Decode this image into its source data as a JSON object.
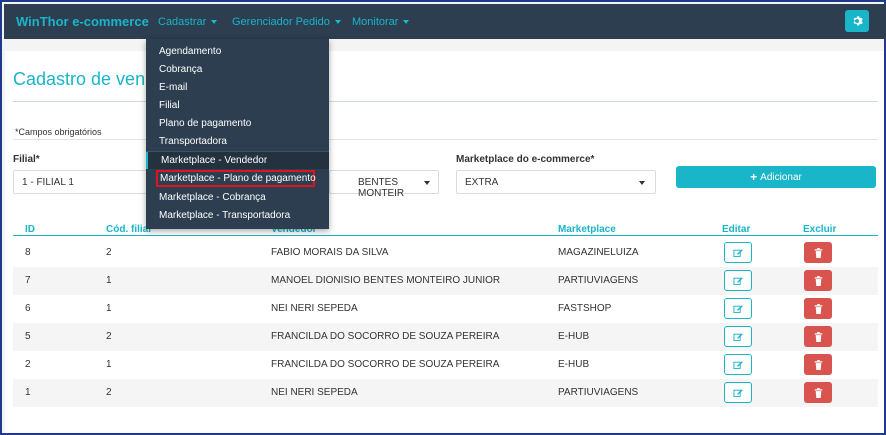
{
  "navbar": {
    "brand": "WinThor e-commerce",
    "menus": [
      {
        "label": "Cadastrar"
      },
      {
        "label": "Gerenciador Pedido"
      },
      {
        "label": "Monitorar"
      }
    ],
    "settings_icon": "gear-icon"
  },
  "dropdown": {
    "items": [
      "Agendamento",
      "Cobrança",
      "E-mail",
      "Filial",
      "Plano de pagamento",
      "Transportadora",
      "Marketplace - Vendedor",
      "Marketplace - Plano de pagamento",
      "Marketplace - Cobrança",
      "Marketplace - Transportadora"
    ]
  },
  "page": {
    "title": "Cadastro de vend",
    "required_note": "*Campos obrigatórios"
  },
  "form": {
    "filial_label": "Filial*",
    "filial_value": "1 - FILIAL 1",
    "vendedor_value": "BENTES MONTEIR",
    "marketplace_label": "Marketplace do e-commerce*",
    "marketplace_value": "EXTRA",
    "add_button": "Adicionar"
  },
  "table": {
    "headers": {
      "id": "ID",
      "filial": "Cód. filial",
      "vendedor": "Vendedor",
      "marketplace": "Marketplace",
      "editar": "Editar",
      "excluir": "Excluir"
    },
    "rows": [
      {
        "id": "8",
        "filial": "2",
        "vendedor": "FABIO MORAIS DA SILVA",
        "marketplace": "MAGAZINELUIZA"
      },
      {
        "id": "7",
        "filial": "1",
        "vendedor": "MANOEL DIONISIO BENTES MONTEIRO JUNIOR",
        "marketplace": "PARTIUVIAGENS"
      },
      {
        "id": "6",
        "filial": "1",
        "vendedor": "NEI NERI SEPEDA",
        "marketplace": "FASTSHOP"
      },
      {
        "id": "5",
        "filial": "2",
        "vendedor": "FRANCILDA DO SOCORRO DE SOUZA PEREIRA",
        "marketplace": "E-HUB"
      },
      {
        "id": "2",
        "filial": "1",
        "vendedor": "FRANCILDA DO SOCORRO DE SOUZA PEREIRA",
        "marketplace": "E-HUB"
      },
      {
        "id": "1",
        "filial": "2",
        "vendedor": "NEI NERI SEPEDA",
        "marketplace": "PARTIUVIAGENS"
      }
    ]
  },
  "colors": {
    "navbar": "#2c3e50",
    "accent": "#19b5c8",
    "danger": "#d9534f",
    "highlight_box": "#e0141c"
  }
}
